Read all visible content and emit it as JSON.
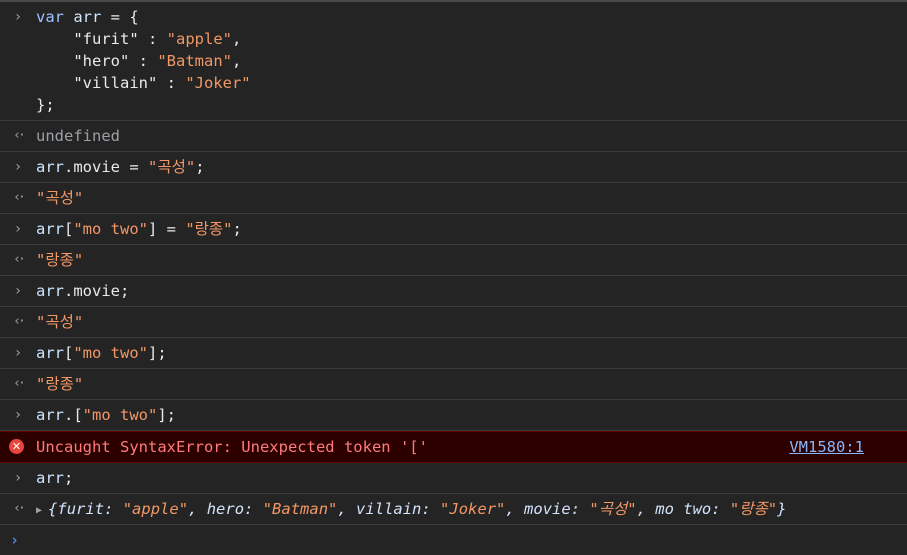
{
  "entries": [
    {
      "type": "input",
      "lines": [
        [
          {
            "t": "var",
            "c": "kw"
          },
          {
            "t": " ",
            "c": "punc"
          },
          {
            "t": "arr",
            "c": "var"
          },
          {
            "t": " = {",
            "c": "punc"
          }
        ],
        [
          {
            "t": "    \"furit\" : ",
            "c": "key"
          },
          {
            "t": "\"apple\"",
            "c": "str"
          },
          {
            "t": ",",
            "c": "punc"
          }
        ],
        [
          {
            "t": "    \"hero\" : ",
            "c": "key"
          },
          {
            "t": "\"Batman\"",
            "c": "str"
          },
          {
            "t": ",",
            "c": "punc"
          }
        ],
        [
          {
            "t": "    \"villain\" : ",
            "c": "key"
          },
          {
            "t": "\"Joker\"",
            "c": "str"
          }
        ],
        [
          {
            "t": "};",
            "c": "punc"
          }
        ]
      ]
    },
    {
      "type": "output",
      "lines": [
        [
          {
            "t": "undefined",
            "c": "muted"
          }
        ]
      ]
    },
    {
      "type": "input",
      "lines": [
        [
          {
            "t": "arr",
            "c": "var"
          },
          {
            "t": ".movie = ",
            "c": "punc"
          },
          {
            "t": "\"곡성\"",
            "c": "str"
          },
          {
            "t": ";",
            "c": "punc"
          }
        ]
      ]
    },
    {
      "type": "output",
      "lines": [
        [
          {
            "t": "\"곡성\"",
            "c": "str"
          }
        ]
      ]
    },
    {
      "type": "input",
      "lines": [
        [
          {
            "t": "arr",
            "c": "var"
          },
          {
            "t": "[",
            "c": "punc"
          },
          {
            "t": "\"mo two\"",
            "c": "str"
          },
          {
            "t": "] = ",
            "c": "punc"
          },
          {
            "t": "\"랑종\"",
            "c": "str"
          },
          {
            "t": ";",
            "c": "punc"
          }
        ]
      ]
    },
    {
      "type": "output",
      "lines": [
        [
          {
            "t": "\"랑종\"",
            "c": "str"
          }
        ]
      ]
    },
    {
      "type": "input",
      "lines": [
        [
          {
            "t": "arr",
            "c": "var"
          },
          {
            "t": ".movie;",
            "c": "punc"
          }
        ]
      ]
    },
    {
      "type": "output",
      "lines": [
        [
          {
            "t": "\"곡성\"",
            "c": "str"
          }
        ]
      ]
    },
    {
      "type": "input",
      "lines": [
        [
          {
            "t": "arr",
            "c": "var"
          },
          {
            "t": "[",
            "c": "punc"
          },
          {
            "t": "\"mo two\"",
            "c": "str"
          },
          {
            "t": "];",
            "c": "punc"
          }
        ]
      ]
    },
    {
      "type": "output",
      "lines": [
        [
          {
            "t": "\"랑종\"",
            "c": "str"
          }
        ]
      ]
    },
    {
      "type": "input",
      "lines": [
        [
          {
            "t": "arr",
            "c": "var"
          },
          {
            "t": ".[",
            "c": "punc"
          },
          {
            "t": "\"mo two\"",
            "c": "str"
          },
          {
            "t": "];",
            "c": "punc"
          }
        ]
      ]
    },
    {
      "type": "error",
      "message": "Uncaught SyntaxError: Unexpected token '['",
      "source": "VM1580:1"
    },
    {
      "type": "input",
      "lines": [
        [
          {
            "t": "arr",
            "c": "var"
          },
          {
            "t": ";",
            "c": "punc"
          }
        ]
      ]
    },
    {
      "type": "object",
      "lines": [
        [
          {
            "t": "{",
            "c": "objk"
          },
          {
            "t": "furit",
            "c": "objk"
          },
          {
            "t": ": ",
            "c": "objk"
          },
          {
            "t": "\"apple\"",
            "c": "objv"
          },
          {
            "t": ", ",
            "c": "objk"
          },
          {
            "t": "hero",
            "c": "objk"
          },
          {
            "t": ": ",
            "c": "objk"
          },
          {
            "t": "\"Batman\"",
            "c": "objv"
          },
          {
            "t": ", ",
            "c": "objk"
          },
          {
            "t": "villain",
            "c": "objk"
          },
          {
            "t": ": ",
            "c": "objk"
          },
          {
            "t": "\"Joker\"",
            "c": "objv"
          },
          {
            "t": ", ",
            "c": "objk"
          },
          {
            "t": "movie",
            "c": "objk"
          },
          {
            "t": ": ",
            "c": "objk"
          },
          {
            "t": "\"곡성\"",
            "c": "objv"
          },
          {
            "t": ", ",
            "c": "objk"
          },
          {
            "t": "mo two",
            "c": "objk"
          },
          {
            "t": ": ",
            "c": "objk"
          },
          {
            "t": "\"랑종\"",
            "c": "objv"
          },
          {
            "t": "}",
            "c": "objk"
          }
        ]
      ]
    }
  ],
  "prompt": {
    "value": ""
  },
  "colors": {
    "background": "#242424",
    "string": "#f29766",
    "keyword": "#9cc2ff",
    "error_bg": "#2d0000",
    "error_text": "#ff7a7a",
    "link": "#8ab4f8"
  }
}
